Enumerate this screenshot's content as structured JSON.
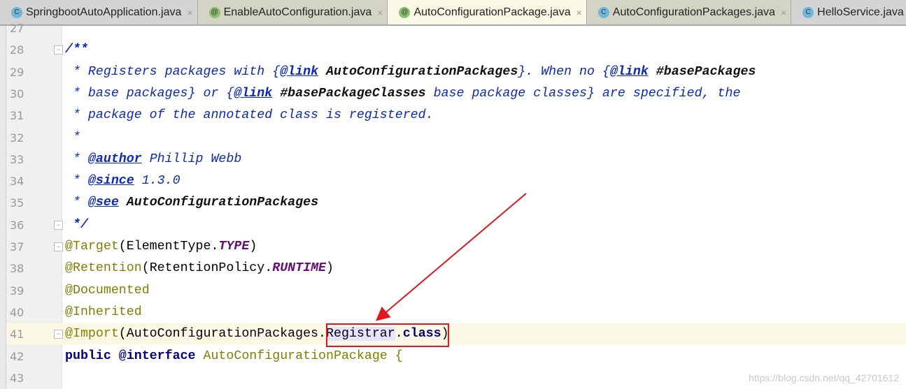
{
  "tabs": [
    {
      "label": "SpringbootAutoApplication.java",
      "icon": "spring-run-class-icon",
      "icon_glyph": "C",
      "icon_color": "#6fb6d8",
      "style": "normal"
    },
    {
      "label": "EnableAutoConfiguration.java",
      "icon": "annotation-icon",
      "icon_glyph": "@",
      "icon_color": "#8cc070",
      "style": "olive"
    },
    {
      "label": "AutoConfigurationPackage.java",
      "icon": "annotation-icon",
      "icon_glyph": "@",
      "icon_color": "#8cc070",
      "style": "active"
    },
    {
      "label": "AutoConfigurationPackages.java",
      "icon": "class-icon",
      "icon_glyph": "C",
      "icon_color": "#6fb6d8",
      "style": "olive"
    },
    {
      "label": "HelloService.java",
      "icon": "class-icon",
      "icon_glyph": "C",
      "icon_color": "#6fb6d8",
      "style": "normal"
    }
  ],
  "close_glyph": "×",
  "lines": [
    {
      "n": "27",
      "tokens": []
    },
    {
      "n": "28",
      "fold": "−",
      "tokens": [
        [
          "/**",
          "docb"
        ]
      ]
    },
    {
      "n": "29",
      "tokens": [
        [
          " * Registers packages with {",
          "doc"
        ],
        [
          "@link",
          "tag"
        ],
        [
          " ",
          "doc"
        ],
        [
          "AutoConfigurationPackages",
          "docref"
        ],
        [
          "}. When no {",
          "doc"
        ],
        [
          "@link",
          "tag"
        ],
        [
          " #basePackages",
          "docref"
        ]
      ]
    },
    {
      "n": "30",
      "tokens": [
        [
          " * base packages} or {",
          "doc"
        ],
        [
          "@link",
          "tag"
        ],
        [
          " #basePackageClasses",
          "docref"
        ],
        [
          " base package classes} are specified, the",
          "doc"
        ]
      ]
    },
    {
      "n": "31",
      "tokens": [
        [
          " * package of the annotated class is registered.",
          "doc"
        ]
      ]
    },
    {
      "n": "32",
      "tokens": [
        [
          " *",
          "doc"
        ]
      ]
    },
    {
      "n": "33",
      "tokens": [
        [
          " * ",
          "doc"
        ],
        [
          "@author",
          "tag"
        ],
        [
          " Phillip Webb",
          "doc"
        ]
      ]
    },
    {
      "n": "34",
      "tokens": [
        [
          " * ",
          "doc"
        ],
        [
          "@since",
          "tag"
        ],
        [
          " 1.3.0",
          "doc"
        ]
      ]
    },
    {
      "n": "35",
      "tokens": [
        [
          " * ",
          "doc"
        ],
        [
          "@see",
          "tag"
        ],
        [
          " AutoConfigurationPackages",
          "docref"
        ]
      ]
    },
    {
      "n": "36",
      "fold": "−",
      "tokens": [
        [
          " */",
          "docb"
        ]
      ]
    },
    {
      "n": "37",
      "fold": "−",
      "tokens": [
        [
          "@Target",
          "ann"
        ],
        [
          "(ElementType.",
          "plain"
        ],
        [
          "TYPE",
          "const"
        ],
        [
          ")",
          "plain"
        ]
      ]
    },
    {
      "n": "38",
      "tokens": [
        [
          "@Retention",
          "ann"
        ],
        [
          "(RetentionPolicy.",
          "plain"
        ],
        [
          "RUNTIME",
          "const"
        ],
        [
          ")",
          "plain"
        ]
      ]
    },
    {
      "n": "39",
      "tokens": [
        [
          "@Documented",
          "ann"
        ]
      ]
    },
    {
      "n": "40",
      "tokens": [
        [
          "@Inherited",
          "ann"
        ]
      ]
    },
    {
      "n": "41",
      "fold": "−",
      "highlight": true,
      "tokens": [
        [
          "@Import",
          "ann"
        ],
        [
          "(AutoConfigurationPackages.",
          "plain"
        ],
        [
          "Registrar",
          "sel"
        ],
        [
          ".",
          "plain"
        ],
        [
          "class",
          "kw"
        ],
        [
          ")",
          "plain"
        ]
      ]
    },
    {
      "n": "42",
      "tokens": [
        [
          "public @interface ",
          "kw"
        ],
        [
          "AutoConfigurationPackage {",
          "ann"
        ]
      ]
    },
    {
      "n": "43",
      "tokens": []
    }
  ],
  "annotation": {
    "box_color": "#e8141e",
    "arrow_color": "#e8141e"
  },
  "watermark": "https://blog.csdn.net/qq_42701612"
}
